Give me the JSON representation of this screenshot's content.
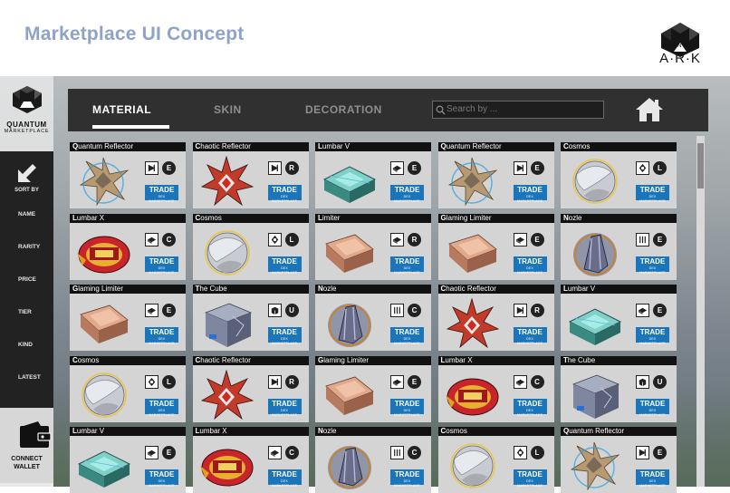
{
  "page": {
    "title": "Marketplace UI Concept"
  },
  "brand": {
    "top_word": "QUANTUM",
    "ark": "A·R·K"
  },
  "sidebar": {
    "brand_name": "QUANTUM",
    "brand_sub": "MARKETPLACE",
    "sort_label": "SORT BY",
    "options": [
      "NAME",
      "RARITY",
      "PRICE",
      "TIER",
      "KIND",
      "LATEST"
    ],
    "wallet_label_1": "CONNECT",
    "wallet_label_2": "WALLET"
  },
  "tabs": [
    {
      "label": "MATERIAL",
      "active": true
    },
    {
      "label": "SKIN",
      "active": false
    },
    {
      "label": "DECORATION",
      "active": false
    }
  ],
  "search": {
    "placeholder": "Search by ..."
  },
  "trade": {
    "label": "TRADE",
    "sub": "DEX MARKETPLACE"
  },
  "colors": {
    "accent": "#1a75bb",
    "title": "#8fa3c8",
    "panel": "#303030"
  },
  "cards": [
    {
      "name": "Quantum Reflector",
      "kind": "reflector",
      "badge": "E",
      "badge_bg": "#222"
    },
    {
      "name": "Chaotic Reflector",
      "kind": "chaotic",
      "badge": "R",
      "badge_bg": "#222"
    },
    {
      "name": "Lumbar V",
      "kind": "lumbar",
      "badge": "E",
      "badge_bg": "#222"
    },
    {
      "name": "Quantum Reflector",
      "kind": "reflector",
      "badge": "E",
      "badge_bg": "#222"
    },
    {
      "name": "Cosmos",
      "kind": "cosmos",
      "badge": "L",
      "badge_bg": "#222"
    },
    {
      "name": "Lumbar X",
      "kind": "lumbarx",
      "badge": "C",
      "badge_bg": "#222"
    },
    {
      "name": "Cosmos",
      "kind": "cosmos",
      "badge": "L",
      "badge_bg": "#222"
    },
    {
      "name": "Limiter",
      "kind": "limiter",
      "badge": "R",
      "badge_bg": "#222"
    },
    {
      "name": "Glaming Limiter",
      "kind": "limiter",
      "badge": "E",
      "badge_bg": "#222"
    },
    {
      "name": "Nozle",
      "kind": "nozle",
      "badge": "E",
      "badge_bg": "#222"
    },
    {
      "name": "Glaming Limiter",
      "kind": "limiter",
      "badge": "E",
      "badge_bg": "#222"
    },
    {
      "name": "The Cube",
      "kind": "cube",
      "badge": "U",
      "badge_bg": "#222"
    },
    {
      "name": "Nozle",
      "kind": "nozle",
      "badge": "C",
      "badge_bg": "#222"
    },
    {
      "name": "Chaotic Reflector",
      "kind": "chaotic",
      "badge": "R",
      "badge_bg": "#222"
    },
    {
      "name": "Lumbar V",
      "kind": "lumbar",
      "badge": "E",
      "badge_bg": "#222"
    },
    {
      "name": "Cosmos",
      "kind": "cosmos",
      "badge": "L",
      "badge_bg": "#222"
    },
    {
      "name": "Chaotic Reflector",
      "kind": "chaotic",
      "badge": "R",
      "badge_bg": "#222"
    },
    {
      "name": "Glaming Limiter",
      "kind": "limiter",
      "badge": "E",
      "badge_bg": "#222"
    },
    {
      "name": "Lumbar X",
      "kind": "lumbarx",
      "badge": "C",
      "badge_bg": "#222"
    },
    {
      "name": "The Cube",
      "kind": "cube",
      "badge": "U",
      "badge_bg": "#222"
    },
    {
      "name": "Lumbar V",
      "kind": "lumbar",
      "badge": "E",
      "badge_bg": "#222"
    },
    {
      "name": "Lumbar X",
      "kind": "lumbarx",
      "badge": "C",
      "badge_bg": "#222"
    },
    {
      "name": "Nozle",
      "kind": "nozle",
      "badge": "C",
      "badge_bg": "#222"
    },
    {
      "name": "Cosmos",
      "kind": "cosmos",
      "badge": "L",
      "badge_bg": "#222"
    },
    {
      "name": "Quantum Reflector",
      "kind": "reflector",
      "badge": "E",
      "badge_bg": "#222"
    }
  ]
}
